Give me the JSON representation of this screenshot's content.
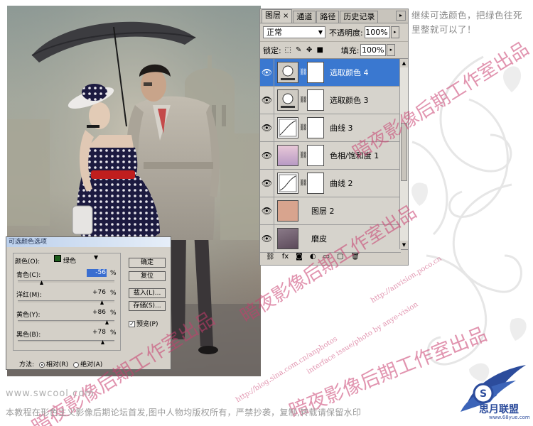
{
  "layers_panel": {
    "tabs": [
      {
        "label": "图层",
        "close": "×"
      },
      {
        "label": "通道"
      },
      {
        "label": "路径"
      },
      {
        "label": "历史记录"
      }
    ],
    "blend_mode": "正常",
    "opacity_label": "不透明度:",
    "opacity_value": "100%",
    "lock_label": "锁定:",
    "fill_label": "填充:",
    "fill_value": "100%",
    "layers": [
      {
        "name": "选取颜色 4",
        "selected": true
      },
      {
        "name": "选取颜色 3"
      },
      {
        "name": "曲线 3"
      },
      {
        "name": "色相/饱和度 1"
      },
      {
        "name": "曲线 2"
      },
      {
        "name": "图层 2"
      },
      {
        "name": "磨皮"
      }
    ],
    "bottom_fx": "fx"
  },
  "dialog": {
    "title": "可选颜色选项",
    "color_label": "颜色(O):",
    "color_value": "绿色",
    "sliders": [
      {
        "label": "青色(C):",
        "value": "-56"
      },
      {
        "label": "洋红(M):",
        "value": "+76"
      },
      {
        "label": "黄色(Y):",
        "value": "+86"
      },
      {
        "label": "黑色(B):",
        "value": "+78"
      }
    ],
    "percent": "%",
    "buttons": {
      "ok": "确定",
      "reset": "复位",
      "load": "载入(L)...",
      "save": "存储(S)..."
    },
    "preview_label": "预览(P)",
    "method_label": "方法:",
    "method_relative": "相对(R)",
    "method_absolute": "绝对(A)"
  },
  "instruction": "继续可选颜色，把绿色往死里整就可以了！",
  "site": "www.swcool.com",
  "copyright": "本教程在形色主义影像后期论坛首发,图中人物均版权所有，严禁抄袭，复制,转载请保留水印",
  "watermarks": {
    "cn_line1": "暗夜影像后期工作室出品",
    "cn_line2": "暗夜影像后期工作室出品",
    "cn_line3": "暗夜影像后期工作室出品",
    "cn_line4": "暗夜影像后期工作室出品",
    "en_line1": "http://blog.sina.com.cn/anphotos",
    "en_line2": "http://anvision.poco.cn",
    "en_line3": "interface issue/photo by anye-vision"
  },
  "logo": {
    "text": "思月联盟",
    "url": "www.68yue.com"
  },
  "colors": {
    "selected_layer": "#3a78d0",
    "watermark": "#c83c6e",
    "panel_bg": "#d4d0c8"
  }
}
